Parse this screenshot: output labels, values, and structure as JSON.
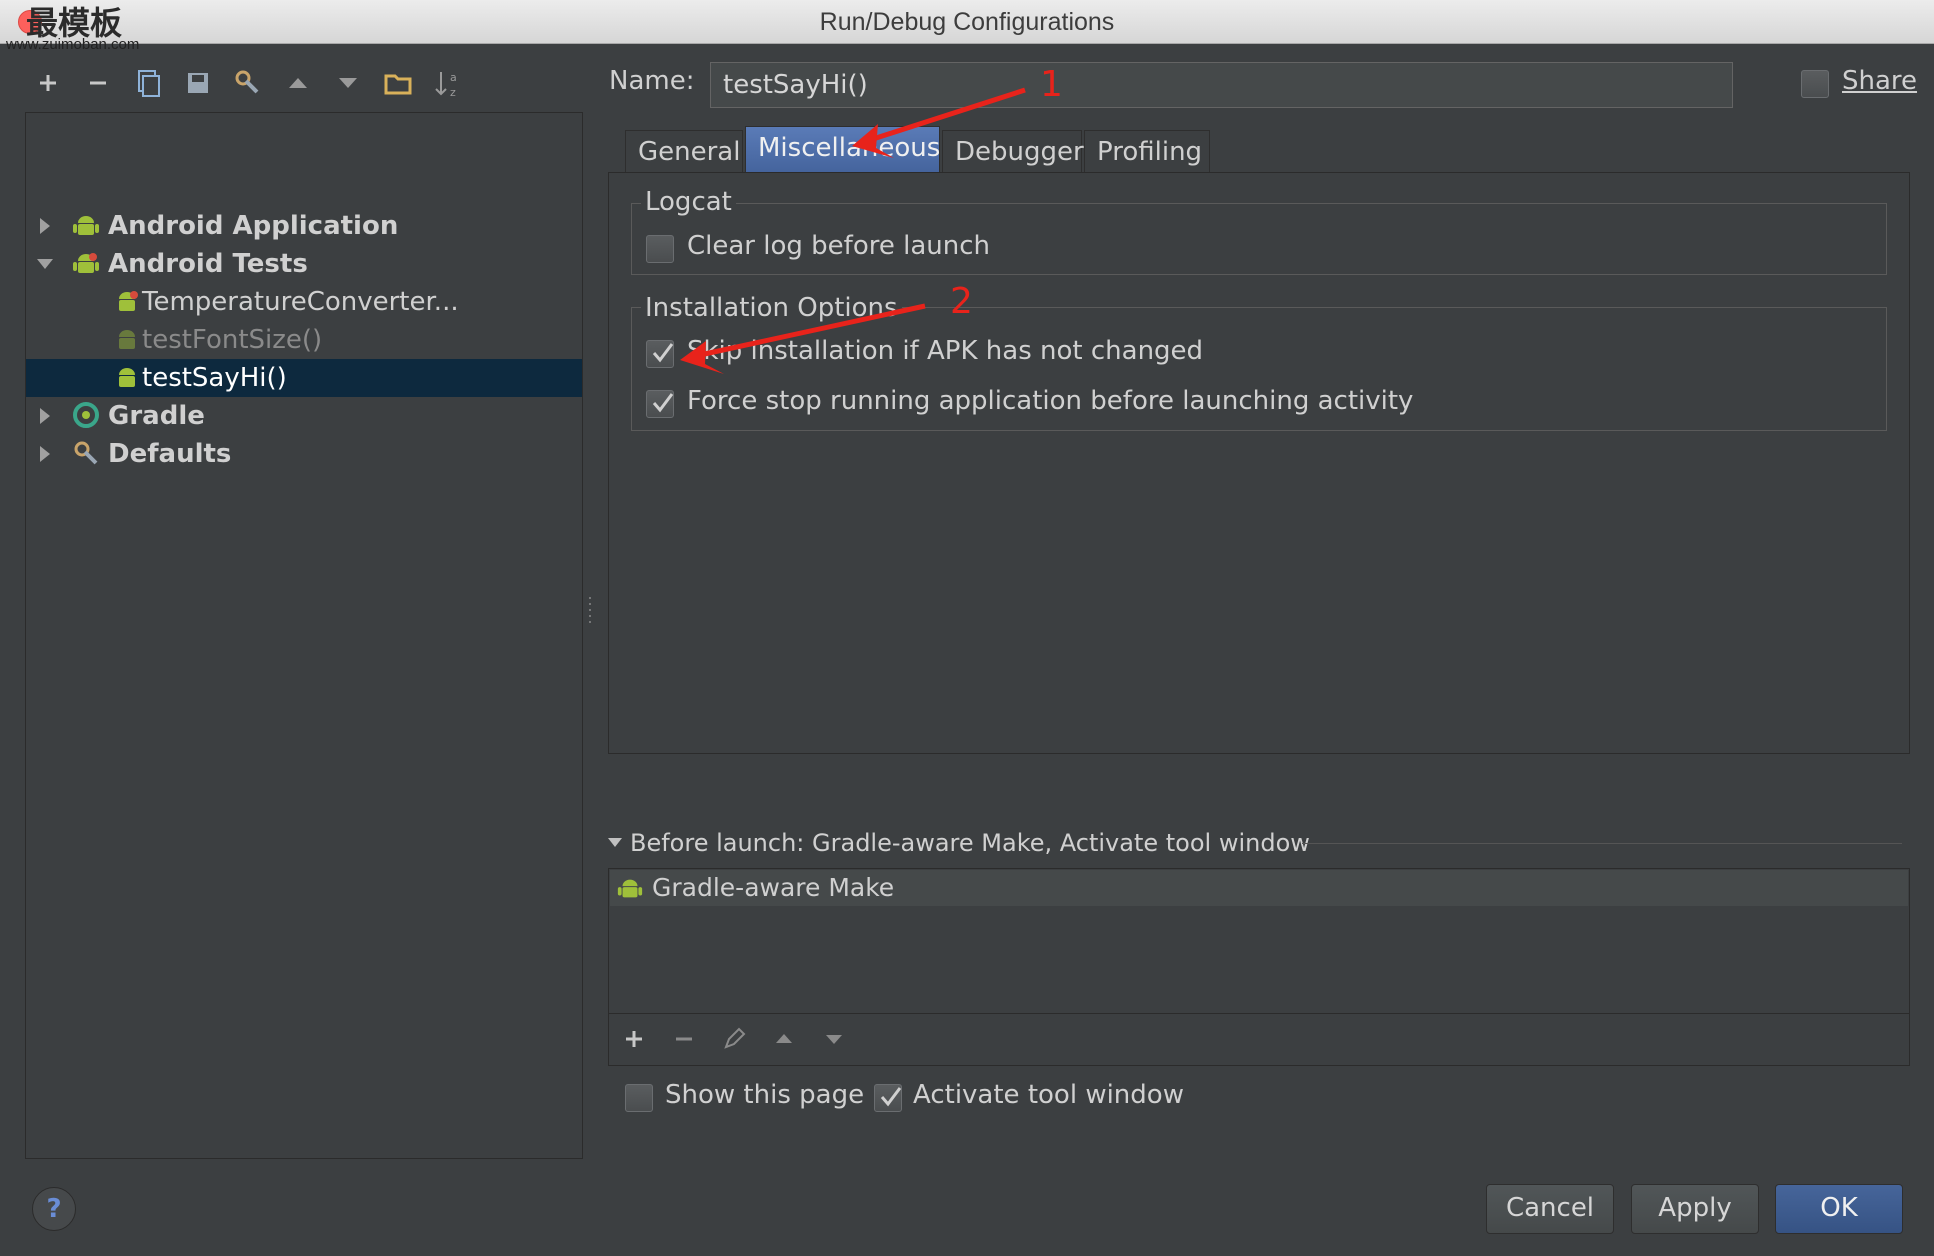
{
  "window": {
    "title": "Run/Debug Configurations"
  },
  "watermark": {
    "text": "最模板",
    "url": "www.zuimoban.com"
  },
  "toolbar": {
    "icons": [
      "add-icon",
      "remove-icon",
      "copy-icon",
      "save-icon",
      "wrench-icon",
      "move-up-icon",
      "move-down-icon",
      "folder-icon",
      "sort-icon"
    ]
  },
  "tree": {
    "items": [
      {
        "label": "Android Application",
        "level": 0,
        "expanded": false,
        "icon": "android-icon"
      },
      {
        "label": "Android Tests",
        "level": 0,
        "expanded": true,
        "icon": "android-icon"
      },
      {
        "label": "TemperatureConverter...",
        "level": 1,
        "icon": "android-test-icon"
      },
      {
        "label": "testFontSize()",
        "level": 1,
        "icon": "android-test-icon",
        "dimmed": true
      },
      {
        "label": "testSayHi()",
        "level": 1,
        "icon": "android-test-icon",
        "selected": true
      },
      {
        "label": "Gradle",
        "level": 0,
        "expanded": false,
        "icon": "gradle-icon"
      },
      {
        "label": "Defaults",
        "level": 0,
        "expanded": false,
        "icon": "defaults-icon"
      }
    ]
  },
  "name": {
    "label": "Name:",
    "value": "testSayHi()"
  },
  "share": {
    "label": "Share",
    "checked": false
  },
  "tabs": [
    {
      "label": "General",
      "active": false
    },
    {
      "label": "Miscellaneous",
      "active": true
    },
    {
      "label": "Debugger",
      "active": false
    },
    {
      "label": "Profiling",
      "active": false
    }
  ],
  "logcat": {
    "title": "Logcat",
    "clear_log": {
      "label": "Clear log before launch",
      "checked": false
    }
  },
  "install": {
    "title": "Installation Options",
    "skip": {
      "label": "Skip installation if APK has not changed",
      "checked": true
    },
    "force_stop": {
      "label": "Force stop running application before launching activity",
      "checked": true
    }
  },
  "before_launch": {
    "label": "Before launch: Gradle-aware Make, Activate tool window",
    "items": [
      "Gradle-aware Make"
    ]
  },
  "show_page": {
    "label": "Show this page",
    "checked": false
  },
  "activate_tool": {
    "label": "Activate tool window",
    "checked": true
  },
  "buttons": {
    "cancel": "Cancel",
    "apply": "Apply",
    "ok": "OK",
    "help": "?"
  },
  "annotations": {
    "first": "1",
    "second": "2",
    "color": "#e8231b"
  },
  "colors": {
    "background": "#3c3f41",
    "selection": "#0d293e",
    "accent": "#4b6eaf",
    "android_green": "#9fc03a"
  }
}
